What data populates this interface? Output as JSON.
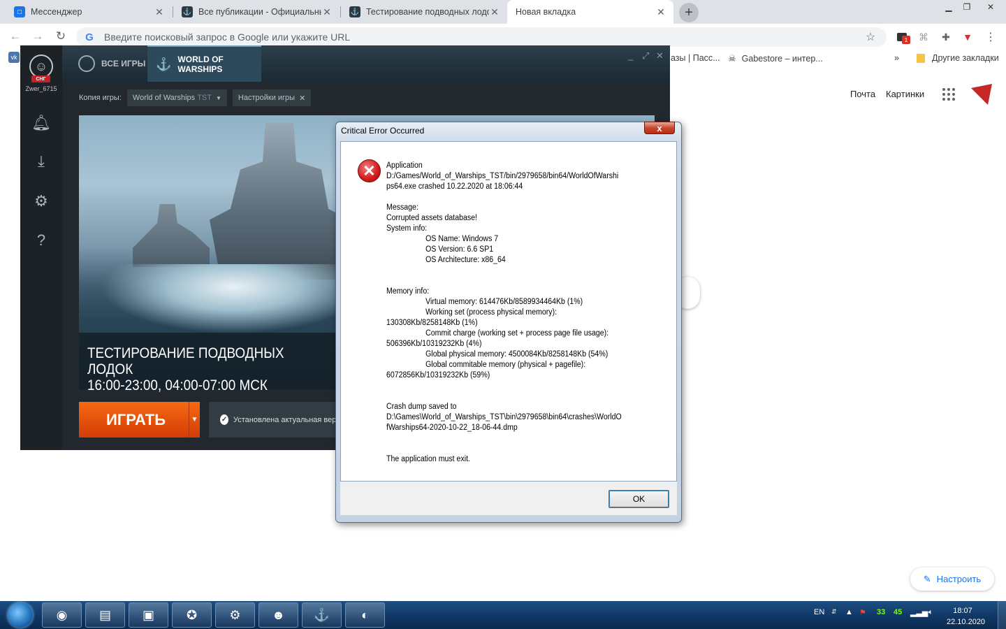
{
  "browser": {
    "tabs": [
      {
        "title": "Мессенджер",
        "icon": "messenger-icon"
      },
      {
        "title": "Все публикации - Официальный",
        "icon": "wows-icon"
      },
      {
        "title": "Тестирование подводных лодок",
        "icon": "wows-icon"
      },
      {
        "title": "Новая вкладка",
        "icon": "none"
      }
    ],
    "new_tab_symbol": "+",
    "omnibox_placeholder": "Введите поисковый запрос в Google или укажите URL",
    "extension_badge": "1",
    "bookmarks": [
      {
        "label": "азы | Пасс..."
      },
      {
        "label": "Gabestore – интер..."
      }
    ],
    "bookmarks_overflow": "»",
    "other_bookmarks": "Другие закладки",
    "google_links": {
      "mail": "Почта",
      "images": "Картинки"
    },
    "customize_label": "Настроить"
  },
  "launcher": {
    "region_badge": "СНГ",
    "username": "Zwer_6715",
    "tab_all_games": "ВСЕ ИГРЫ",
    "tab_game": "WORLD OF WARSHIPS",
    "copy_label": "Копия игры:",
    "copy_value": "World of Warships",
    "copy_suffix": "TST",
    "settings_label": "Настройки игры",
    "banner_title_line1": "ТЕСТИРОВАНИЕ ПОДВОДНЫХ ЛОДОК",
    "banner_title_line2": "16:00-23:00, 04:00-07:00 МСК",
    "play_label": "ИГРАТЬ",
    "status_text": "Установлена актуальная версия"
  },
  "dialog": {
    "title": "Critical Error Occurred",
    "close_symbol": "x",
    "lines": [
      {
        "text": "Application",
        "indent": false
      },
      {
        "text": "D:/Games/World_of_Warships_TST/bin/2979658/bin64/WorldOfWarshi",
        "indent": false
      },
      {
        "text": "ps64.exe crashed 10.22.2020 at 18:06:44",
        "indent": false
      },
      {
        "text": "",
        "indent": false
      },
      {
        "text": "Message:",
        "indent": false
      },
      {
        "text": "Corrupted assets database!",
        "indent": false
      },
      {
        "text": "System info:",
        "indent": false
      },
      {
        "text": "OS Name: Windows 7",
        "indent": true
      },
      {
        "text": "OS Version: 6.6 SP1",
        "indent": true
      },
      {
        "text": "OS Architecture: x86_64",
        "indent": true
      },
      {
        "text": "",
        "indent": false
      },
      {
        "text": "",
        "indent": false
      },
      {
        "text": "Memory info:",
        "indent": false
      },
      {
        "text": "Virtual memory: 614476Kb/8589934464Kb (1%)",
        "indent": true
      },
      {
        "text": "Working set (process physical memory):",
        "indent": true
      },
      {
        "text": "130308Kb/8258148Kb (1%)",
        "indent": false
      },
      {
        "text": "Commit charge (working set + process page file usage):",
        "indent": true
      },
      {
        "text": "506396Kb/10319232Kb (4%)",
        "indent": false
      },
      {
        "text": "Global physical memory: 4500084Kb/8258148Kb (54%)",
        "indent": true
      },
      {
        "text": "Global commitable memory (physical + pagefile):",
        "indent": true
      },
      {
        "text": "6072856Kb/10319232Kb (59%)",
        "indent": false
      },
      {
        "text": "",
        "indent": false
      },
      {
        "text": "",
        "indent": false
      },
      {
        "text": "Crash dump saved to",
        "indent": false
      },
      {
        "text": "D:\\Games\\World_of_Warships_TST\\bin\\2979658\\bin64\\crashes\\WorldO",
        "indent": false
      },
      {
        "text": "fWarships64-2020-10-22_18-06-44.dmp",
        "indent": false
      },
      {
        "text": "",
        "indent": false
      },
      {
        "text": "",
        "indent": false
      },
      {
        "text": "The application must exit.",
        "indent": false
      }
    ],
    "ok_label": "OK"
  },
  "taskbar": {
    "apps": [
      {
        "name": "chrome",
        "icon": "chrome-icon"
      },
      {
        "name": "explorer",
        "icon": "folder-icon"
      },
      {
        "name": "task-manager",
        "icon": "monitor-icon"
      },
      {
        "name": "clock-app",
        "icon": "compass-icon"
      },
      {
        "name": "steam",
        "icon": "steam-icon"
      },
      {
        "name": "discord",
        "icon": "discord-icon"
      },
      {
        "name": "world-of-warships",
        "icon": "wows-icon"
      },
      {
        "name": "wargaming-center",
        "icon": "wgc-icon"
      }
    ],
    "lang": "EN",
    "tray_temp1": "33",
    "tray_temp2": "45",
    "time": "18:07",
    "date": "22.10.2020"
  },
  "colors": {
    "play_button": "#e0510b",
    "error_red": "#d11a1a",
    "taskbar": "#0f3562",
    "link_blue": "#1a73e8"
  }
}
